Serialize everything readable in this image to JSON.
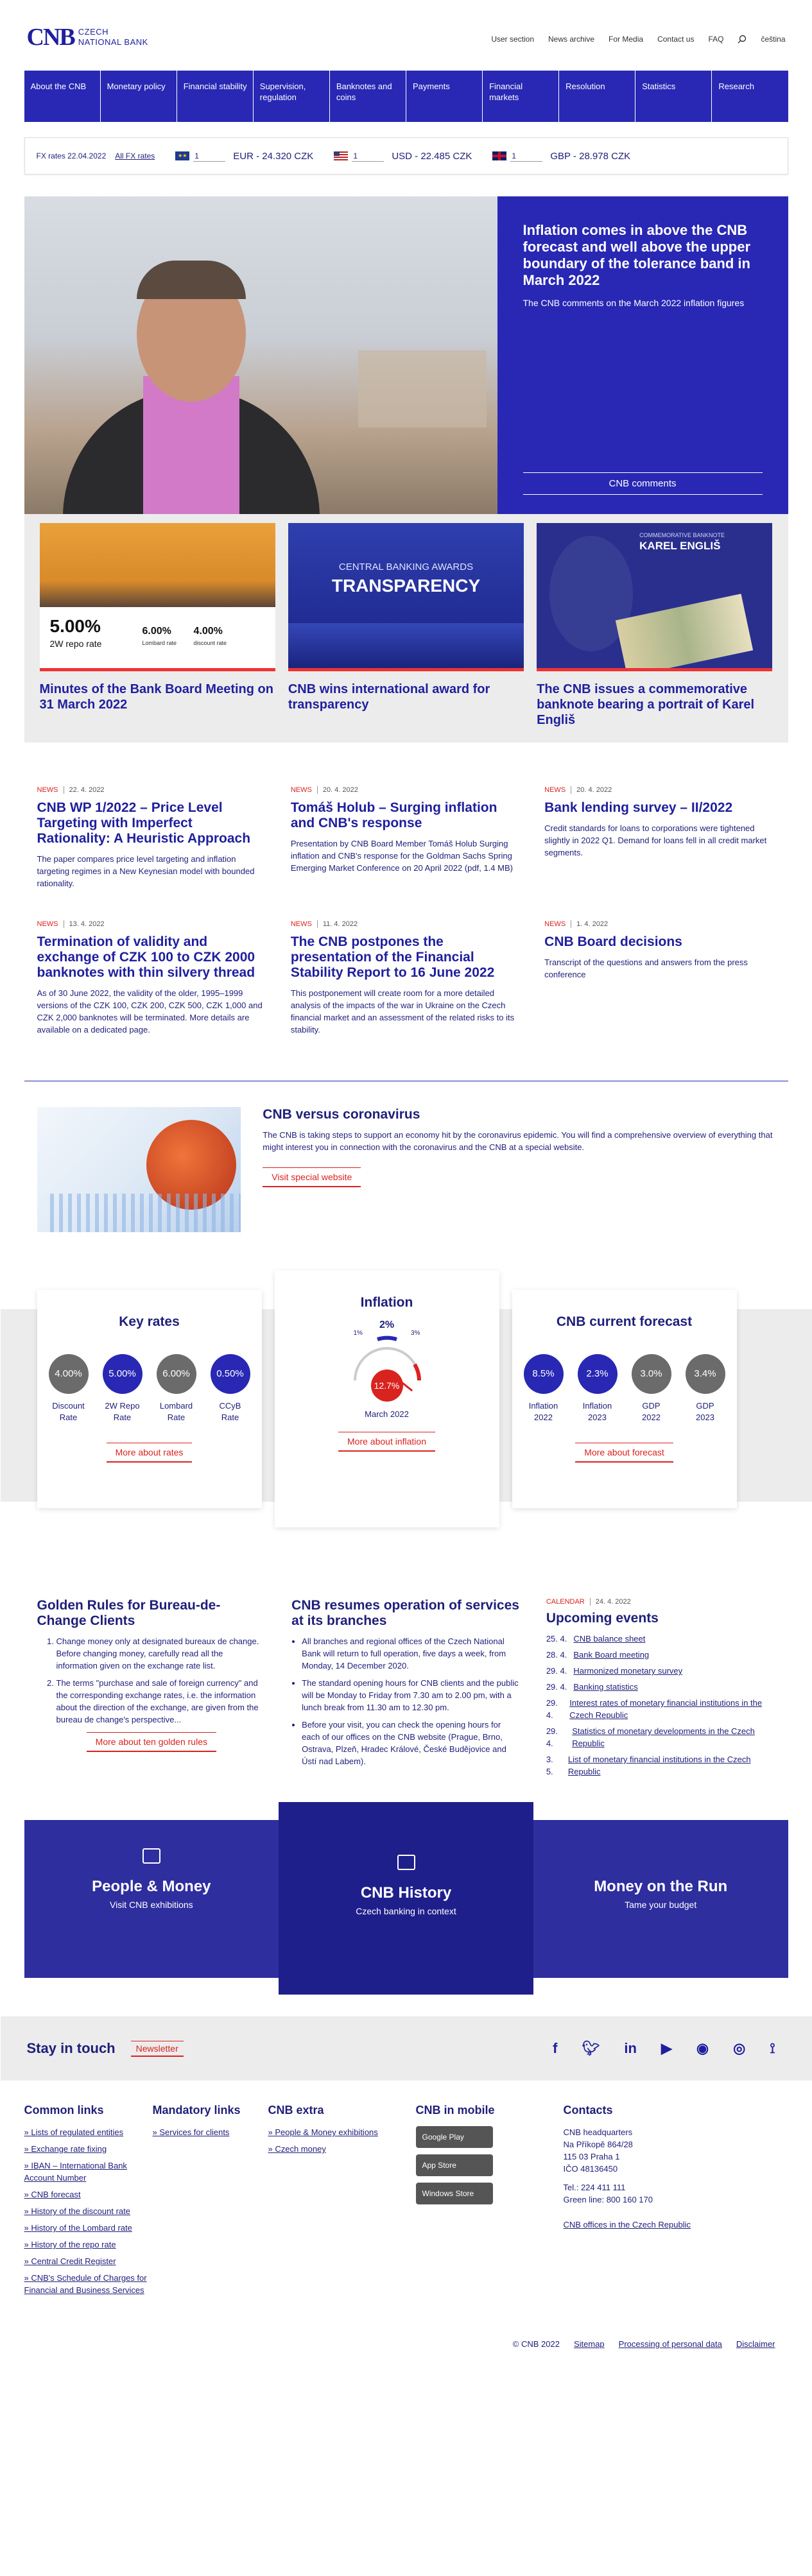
{
  "logo": {
    "mark": "CNB",
    "line1": "CZECH",
    "line2": "NATIONAL BANK"
  },
  "toplinks": [
    "User section",
    "News archive",
    "For Media",
    "Contact us",
    "FAQ",
    "čeština"
  ],
  "nav": [
    "About the CNB",
    "Monetary policy",
    "Financial stability",
    "Supervision, regulation",
    "Banknotes and coins",
    "Payments",
    "Financial markets",
    "Resolution",
    "Statistics",
    "Research"
  ],
  "fx": {
    "label": "FX rates 22.04.2022",
    "all": "All FX rates",
    "pairs": [
      {
        "amount": "1",
        "text": "EUR - 24.320 CZK"
      },
      {
        "amount": "1",
        "text": "USD - 22.485 CZK"
      },
      {
        "amount": "1",
        "text": "GBP - 28.978 CZK"
      }
    ]
  },
  "hero": {
    "title": "Inflation comes in above the CNB forecast and well above the upper boundary of the tolerance band in March 2022",
    "text": "The CNB comments on the March 2022 inflation figures",
    "button": "CNB comments"
  },
  "cards": [
    {
      "title": "Minutes of the Bank Board Meeting on 31 March 2022",
      "rate_big": "5.00%",
      "rate_big_label": "2W repo rate",
      "rate2": "6.00%",
      "rate2_label": "Lombard rate",
      "rate3": "4.00%",
      "rate3_label": "discount rate"
    },
    {
      "title": "CNB wins international award for transparency",
      "img_line1": "CENTRAL BANKING AWARDS",
      "img_line2": "TRANSPARENCY"
    },
    {
      "title": "The CNB issues a commemorative banknote bearing a portrait of Karel Engliš",
      "img_line1": "COMMEMORATIVE BANKNOTE",
      "img_line2": "KAREL ENGLIŠ"
    }
  ],
  "news": [
    {
      "tag": "NEWS",
      "date": "22. 4. 2022",
      "title": "CNB WP 1/2022 – Price Level Targeting with Imperfect Rationality: A Heuristic Approach",
      "text": "The paper compares price level targeting and inflation targeting regimes in a New Keynesian model with bounded rationality."
    },
    {
      "tag": "NEWS",
      "date": "20. 4. 2022",
      "title": "Tomáš Holub – Surging inflation and CNB's response",
      "text": "Presentation by CNB Board Member Tomáš Holub Surging inflation and CNB's response for the Goldman Sachs Spring Emerging Market Conference on 20 April 2022 (pdf, 1.4 MB)"
    },
    {
      "tag": "NEWS",
      "date": "20. 4. 2022",
      "title": "Bank lending survey – II/2022",
      "text": "Credit standards for loans to corporations were tightened slightly in 2022 Q1. Demand for loans fell in all credit market segments."
    },
    {
      "tag": "NEWS",
      "date": "13. 4. 2022",
      "title": "Termination of validity and exchange of CZK 100 to CZK 2000 banknotes with thin silvery thread",
      "text": "As of 30 June 2022, the validity of the older, 1995–1999 versions of the CZK 100, CZK 200, CZK 500, CZK 1,000 and CZK 2,000 banknotes will be terminated. More details are available on a dedicated page."
    },
    {
      "tag": "NEWS",
      "date": "11. 4. 2022",
      "title": "The CNB postpones the presentation of the Financial Stability Report to 16 June 2022",
      "text": "This postponement will create room for a more detailed analysis of the impacts of the war in Ukraine on the Czech financial market and an assessment of the related risks to its stability."
    },
    {
      "tag": "NEWS",
      "date": "1. 4. 2022",
      "title": "CNB Board decisions",
      "text": "Transcript of the questions and answers from the press conference"
    }
  ],
  "corona": {
    "title": "CNB versus coronavirus",
    "text": "The CNB is taking steps to support an economy hit by the coronavirus epidemic. You will find a comprehensive overview of everything that might interest you in connection with the coronavirus and the CNB at a special website.",
    "button": "Visit special website"
  },
  "keyrates": {
    "title": "Key rates",
    "items": [
      {
        "value": "4.00%",
        "label1": "Discount",
        "label2": "Rate",
        "color": "gray"
      },
      {
        "value": "5.00%",
        "label1": "2W Repo",
        "label2": "Rate",
        "color": "blue"
      },
      {
        "value": "6.00%",
        "label1": "Lombard",
        "label2": "Rate",
        "color": "gray"
      },
      {
        "value": "0.50%",
        "label1": "CCyB",
        "label2": "Rate",
        "color": "blue"
      }
    ],
    "button": "More about rates"
  },
  "inflation": {
    "title": "Inflation",
    "target": "2%",
    "low": "1%",
    "high": "3%",
    "value": "12.7%",
    "value_num": 12.7,
    "period": "March 2022",
    "button": "More about inflation"
  },
  "forecast": {
    "title": "CNB current forecast",
    "items": [
      {
        "value": "8.5%",
        "label1": "Inflation",
        "label2": "2022",
        "color": "blue"
      },
      {
        "value": "2.3%",
        "label1": "Inflation",
        "label2": "2023",
        "color": "blue"
      },
      {
        "value": "3.0%",
        "label1": "GDP",
        "label2": "2022",
        "color": "gray"
      },
      {
        "value": "3.4%",
        "label1": "GDP",
        "label2": "2023",
        "color": "gray"
      }
    ],
    "button": "More about forecast"
  },
  "golden": {
    "title": "Golden Rules for Bureau-de-Change Clients",
    "items": [
      "Change money only at designated bureaux de change. Before changing money, carefully read all the information given on the exchange rate list.",
      "The terms \"purchase and sale of foreign currency\" and the corresponding exchange rates, i.e. the information about the direction of the exchange, are given from the bureau de change's perspective..."
    ],
    "button": "More about ten golden rules"
  },
  "resume": {
    "title": "CNB resumes operation of services at its branches",
    "items": [
      "All branches and regional offices of the Czech National Bank will return to full operation, five days a week, from Monday, 14 December 2020.",
      "The standard opening hours for CNB clients and the public will be Monday to Friday from 7.30 am to 2.00 pm, with a lunch break from 11.30 am to 12.30 pm.",
      "Before your visit, you can check the opening hours for each of our offices on the CNB website (Prague, Brno, Ostrava, Plzeň, Hradec Králové, České Budějovice and Ústí nad Labem)."
    ]
  },
  "events": {
    "tag": "CALENDAR",
    "date": "24. 4. 2022",
    "title": "Upcoming events",
    "items": [
      {
        "d": "25. 4.",
        "t": "CNB balance sheet"
      },
      {
        "d": "28. 4.",
        "t": "Bank Board meeting"
      },
      {
        "d": "29. 4.",
        "t": "Harmonized monetary survey"
      },
      {
        "d": "29. 4.",
        "t": "Banking statistics"
      },
      {
        "d": "29. 4.",
        "t": "Interest rates of monetary financial institutions in the Czech Republic"
      },
      {
        "d": "29. 4.",
        "t": "Statistics of monetary developments in the Czech Republic"
      },
      {
        "d": "3. 5.",
        "t": "List of monetary financial institutions in the Czech Republic"
      }
    ]
  },
  "banners": [
    {
      "title": "People & Money",
      "sub": "Visit CNB exhibitions"
    },
    {
      "title": "CNB History",
      "sub": "Czech banking in context"
    },
    {
      "title": "Money on the Run",
      "sub": "Tame your budget"
    }
  ],
  "stay": {
    "title": "Stay in touch",
    "newsletter": "Newsletter"
  },
  "footer": {
    "common": {
      "title": "Common links",
      "items": [
        "Lists of regulated entities",
        "Exchange rate fixing",
        "IBAN – International Bank Account Number",
        "CNB forecast",
        "History of the discount rate",
        "History of the Lombard rate",
        "History of the repo rate",
        "Central Credit Register",
        "CNB's Schedule of Charges for Financial and Business Services"
      ]
    },
    "mandatory": {
      "title": "Mandatory links",
      "items": [
        "Services for clients"
      ]
    },
    "extra": {
      "title": "CNB extra",
      "items": [
        "People & Money exhibitions",
        "Czech money"
      ]
    },
    "mobile": {
      "title": "CNB in mobile",
      "stores": [
        "Google Play",
        "App Store",
        "Windows Store"
      ]
    },
    "contacts": {
      "title": "Contacts",
      "lines": [
        "CNB headquarters",
        "Na Příkopě 864/28",
        "115 03 Praha 1",
        "IČO 48136450",
        "",
        "Tel.: 224 411 111",
        "Green line: 800 160 170"
      ],
      "link": "CNB offices in the Czech Republic"
    },
    "bottom": [
      "© CNB 2022",
      "Sitemap",
      "Processing of personal data",
      "Disclaimer"
    ]
  }
}
